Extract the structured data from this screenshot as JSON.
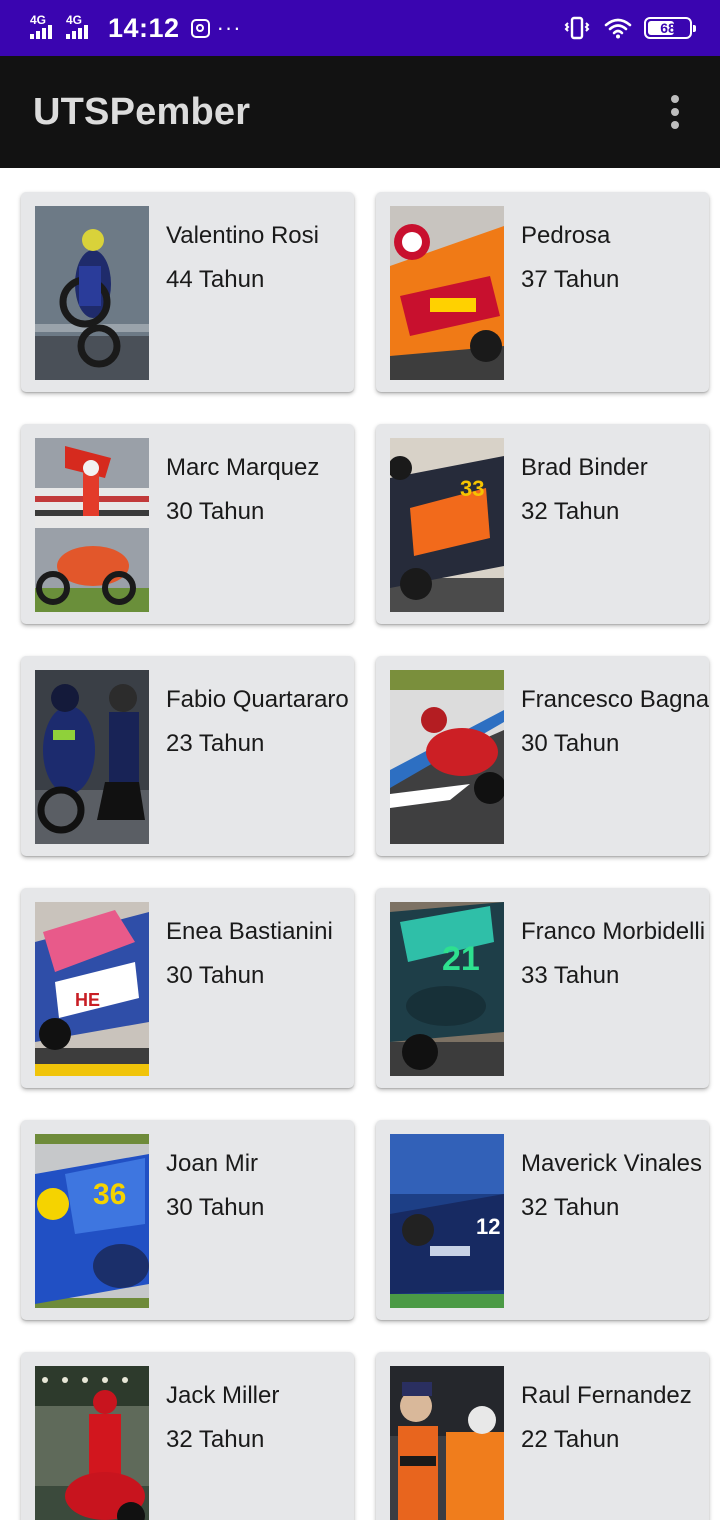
{
  "status_bar": {
    "network_1": "4G",
    "network_2": "4G",
    "time": "14:12",
    "battery": "68",
    "battery_level": 0.68,
    "icons": [
      "signal-icon",
      "instagram-icon",
      "more-notifications-icon",
      "vibrate-icon",
      "wifi-icon",
      "battery-icon"
    ]
  },
  "app_bar": {
    "title": "UTSPember",
    "menu_icon": "overflow-menu-icon"
  },
  "riders": [
    {
      "name": "Valentino Rosi",
      "age": "44 Tahun"
    },
    {
      "name": "Pedrosa",
      "age": "37 Tahun"
    },
    {
      "name": "Marc Marquez",
      "age": "30 Tahun"
    },
    {
      "name": "Brad Binder",
      "age": "32 Tahun"
    },
    {
      "name": "Fabio Quartararo",
      "age": "23 Tahun"
    },
    {
      "name": "Francesco Bagnaia",
      "age": "30 Tahun"
    },
    {
      "name": "Enea Bastianini",
      "age": "30 Tahun"
    },
    {
      "name": "Franco Morbidelli",
      "age": "33 Tahun"
    },
    {
      "name": "Joan Mir",
      "age": "30 Tahun"
    },
    {
      "name": "Maverick Vinales",
      "age": "32 Tahun"
    },
    {
      "name": "Jack Miller",
      "age": "32 Tahun"
    },
    {
      "name": "Raul Fernandez",
      "age": "22 Tahun"
    }
  ],
  "colors": {
    "status_bar": "#3a05b0",
    "app_bar": "#121212",
    "card": "#e6e7e9"
  }
}
